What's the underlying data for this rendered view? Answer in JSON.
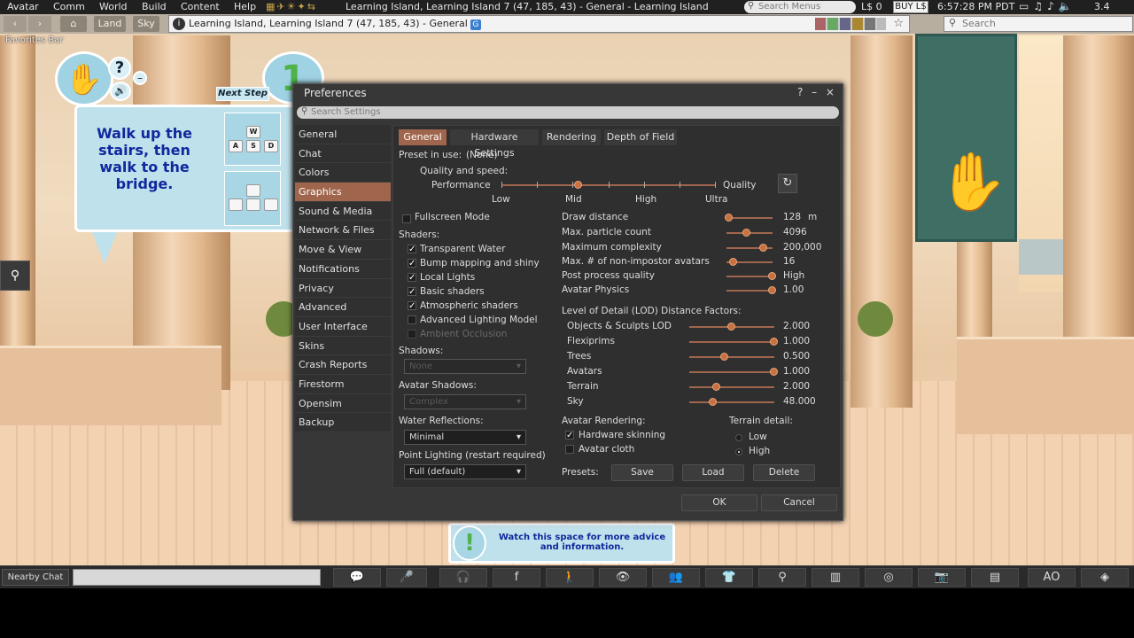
{
  "menubar": {
    "items": [
      "Avatar",
      "Comm",
      "World",
      "Build",
      "Content",
      "Help"
    ],
    "title": "Learning Island, Learning Island 7 (47, 185, 43) - General - Learning Island",
    "search_placeholder": "Search Menus",
    "balance": "L$ 0",
    "buy_label": "BUY L$",
    "time": "6:57:28 PM PDT",
    "fps": "3.4"
  },
  "navbar": {
    "back": "‹",
    "forward": "›",
    "home": "⌂",
    "land": "Land",
    "sky": "Sky",
    "url": "Learning Island, Learning Island 7 (47, 185, 43) - General",
    "search_placeholder": "Search",
    "favorites": "Favorites Bar"
  },
  "hud": {
    "step_number": "1",
    "next_step": "Next Step",
    "instruction": "Walk up the stairs, then walk to the bridge.",
    "keys_top": [
      "W",
      "A",
      "S",
      "D"
    ],
    "hint": "Watch this space for more advice and information."
  },
  "dialog": {
    "title": "Preferences",
    "controls": "? – ×",
    "search_placeholder": "Search Settings",
    "sidebar": [
      "General",
      "Chat",
      "Colors",
      "Graphics",
      "Sound & Media",
      "Network & Files",
      "Move & View",
      "Notifications",
      "Privacy",
      "Advanced",
      "User Interface",
      "Skins",
      "Crash Reports",
      "Firestorm",
      "Opensim",
      "Backup"
    ],
    "tabs": [
      "General",
      "Hardware Settings",
      "Rendering",
      "Depth of Field"
    ],
    "preset_label": "Preset in use:",
    "preset_value": "(None)",
    "quality_label": "Quality and speed:",
    "performance": "Performance",
    "quality": "Quality",
    "quality_levels": [
      "Low",
      "Mid",
      "High",
      "Ultra"
    ],
    "quality_level_value": 0.36,
    "fullscreen": "Fullscreen Mode",
    "shaders_label": "Shaders:",
    "shaders": [
      {
        "label": "Transparent Water",
        "checked": true,
        "enabled": true
      },
      {
        "label": "Bump mapping and shiny",
        "checked": true,
        "enabled": true
      },
      {
        "label": "Local Lights",
        "checked": true,
        "enabled": true
      },
      {
        "label": "Basic shaders",
        "checked": true,
        "enabled": true
      },
      {
        "label": "Atmospheric shaders",
        "checked": true,
        "enabled": true
      },
      {
        "label": "Advanced Lighting Model",
        "checked": false,
        "enabled": true
      },
      {
        "label": "Ambient Occlusion",
        "checked": false,
        "enabled": false
      }
    ],
    "shadows_label": "Shadows:",
    "shadows_value": "None",
    "avatar_shadows_label": "Avatar Shadows:",
    "avatar_shadows_value": "Complex",
    "water_reflections_label": "Water Reflections:",
    "water_reflections_value": "Minimal",
    "point_lighting_label": "Point Lighting (restart required)",
    "point_lighting_value": "Full (default)",
    "sliders": [
      {
        "label": "Draw distance",
        "value": "128",
        "unit": "m",
        "level": 0.05
      },
      {
        "label": "Max. particle count",
        "value": "4096",
        "unit": "",
        "level": 0.45
      },
      {
        "label": "Maximum complexity",
        "value": "200,000",
        "unit": "",
        "level": 0.8
      },
      {
        "label": "Max. # of non-impostor avatars",
        "value": "16",
        "unit": "",
        "level": 0.15
      },
      {
        "label": "Post process quality",
        "value": "High",
        "unit": "",
        "level": 1.0
      },
      {
        "label": "Avatar Physics",
        "value": "1.00",
        "unit": "",
        "level": 1.0
      }
    ],
    "lod_label": "Level of Detail (LOD) Distance Factors:",
    "lod": [
      {
        "label": "Objects & Sculpts LOD",
        "value": "2.000",
        "level": 0.5
      },
      {
        "label": "Flexiprims",
        "value": "1.000",
        "level": 1.0
      },
      {
        "label": "Trees",
        "value": "0.500",
        "level": 0.42
      },
      {
        "label": "Avatars",
        "value": "1.000",
        "level": 1.0
      },
      {
        "label": "Terrain",
        "value": "2.000",
        "level": 0.32
      },
      {
        "label": "Sky",
        "value": "48.000",
        "level": 0.28
      }
    ],
    "avatar_rendering_label": "Avatar Rendering:",
    "hardware_skinning": "Hardware skinning",
    "avatar_cloth": "Avatar cloth",
    "terrain_detail_label": "Terrain detail:",
    "terrain_low": "Low",
    "terrain_high": "High",
    "presets_label": "Presets:",
    "save": "Save",
    "load": "Load",
    "delete": "Delete",
    "ok": "OK",
    "cancel": "Cancel"
  },
  "bottombar": {
    "nearby_chat": "Nearby Chat",
    "ao": "AO"
  },
  "colors": {
    "accent": "#a0664d",
    "dialog_bg": "#373737"
  }
}
